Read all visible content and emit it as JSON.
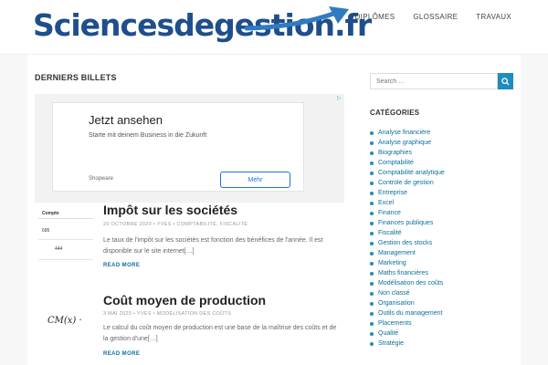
{
  "site": {
    "logo_text": "Sciencesdegestion.fr"
  },
  "nav": {
    "items": [
      "DIPLÔMES",
      "GLOSSAIRE",
      "TRAVAUX"
    ]
  },
  "main": {
    "section_title": "DERNIERS BILLETS",
    "ad": {
      "title": "Jetzt ansehen",
      "subtitle": "Starte mit deinem Business in die Zukunft",
      "brand": "Shopware",
      "button": "Mehr"
    },
    "posts": [
      {
        "title": "Impôt sur les sociétés",
        "meta": "20 OCTOBRE 2020 • YVES • COMPTABILITÉ, FISCALITÉ",
        "excerpt": "Le taux de l'impôt sur les sociétés est fonction des bénéfices de l'année. Il est disponible sur le site internet[…]",
        "read_more": "READ MORE",
        "thumb": {
          "header": "Compte",
          "v1": "695",
          "v2": "444"
        }
      },
      {
        "title": "Coût moyen de production",
        "meta": "3 MAI 2020 • YVES • MODÉLISATION DES COÛTS",
        "excerpt": "Le calcul du coût moyen de production est une base de la maîtrise des coûts et de la gestion d'une[…]",
        "read_more": "READ MORE",
        "thumb": {
          "formula": "CM(x) ·"
        }
      }
    ]
  },
  "sidebar": {
    "search_placeholder": "Search …",
    "categories_title": "CATÉGORIES",
    "categories": [
      "Analyse financière",
      "Analyse graphique",
      "Biographies",
      "Comptabilité",
      "Comptabilité analytique",
      "Controle de gestion",
      "Entreprise",
      "Excel",
      "Finance",
      "Finances publiques",
      "Fiscalité",
      "Gestion des stocks",
      "Management",
      "Marketing",
      "Maths financières",
      "Modélisation des coûts",
      "Non classé",
      "Organisation",
      "Outils du management",
      "Placements",
      "Qualité",
      "Stratégie"
    ]
  },
  "colors": {
    "brand": "#1f4e8c",
    "accent": "#1e8cbe",
    "link": "#0d6e9c"
  }
}
